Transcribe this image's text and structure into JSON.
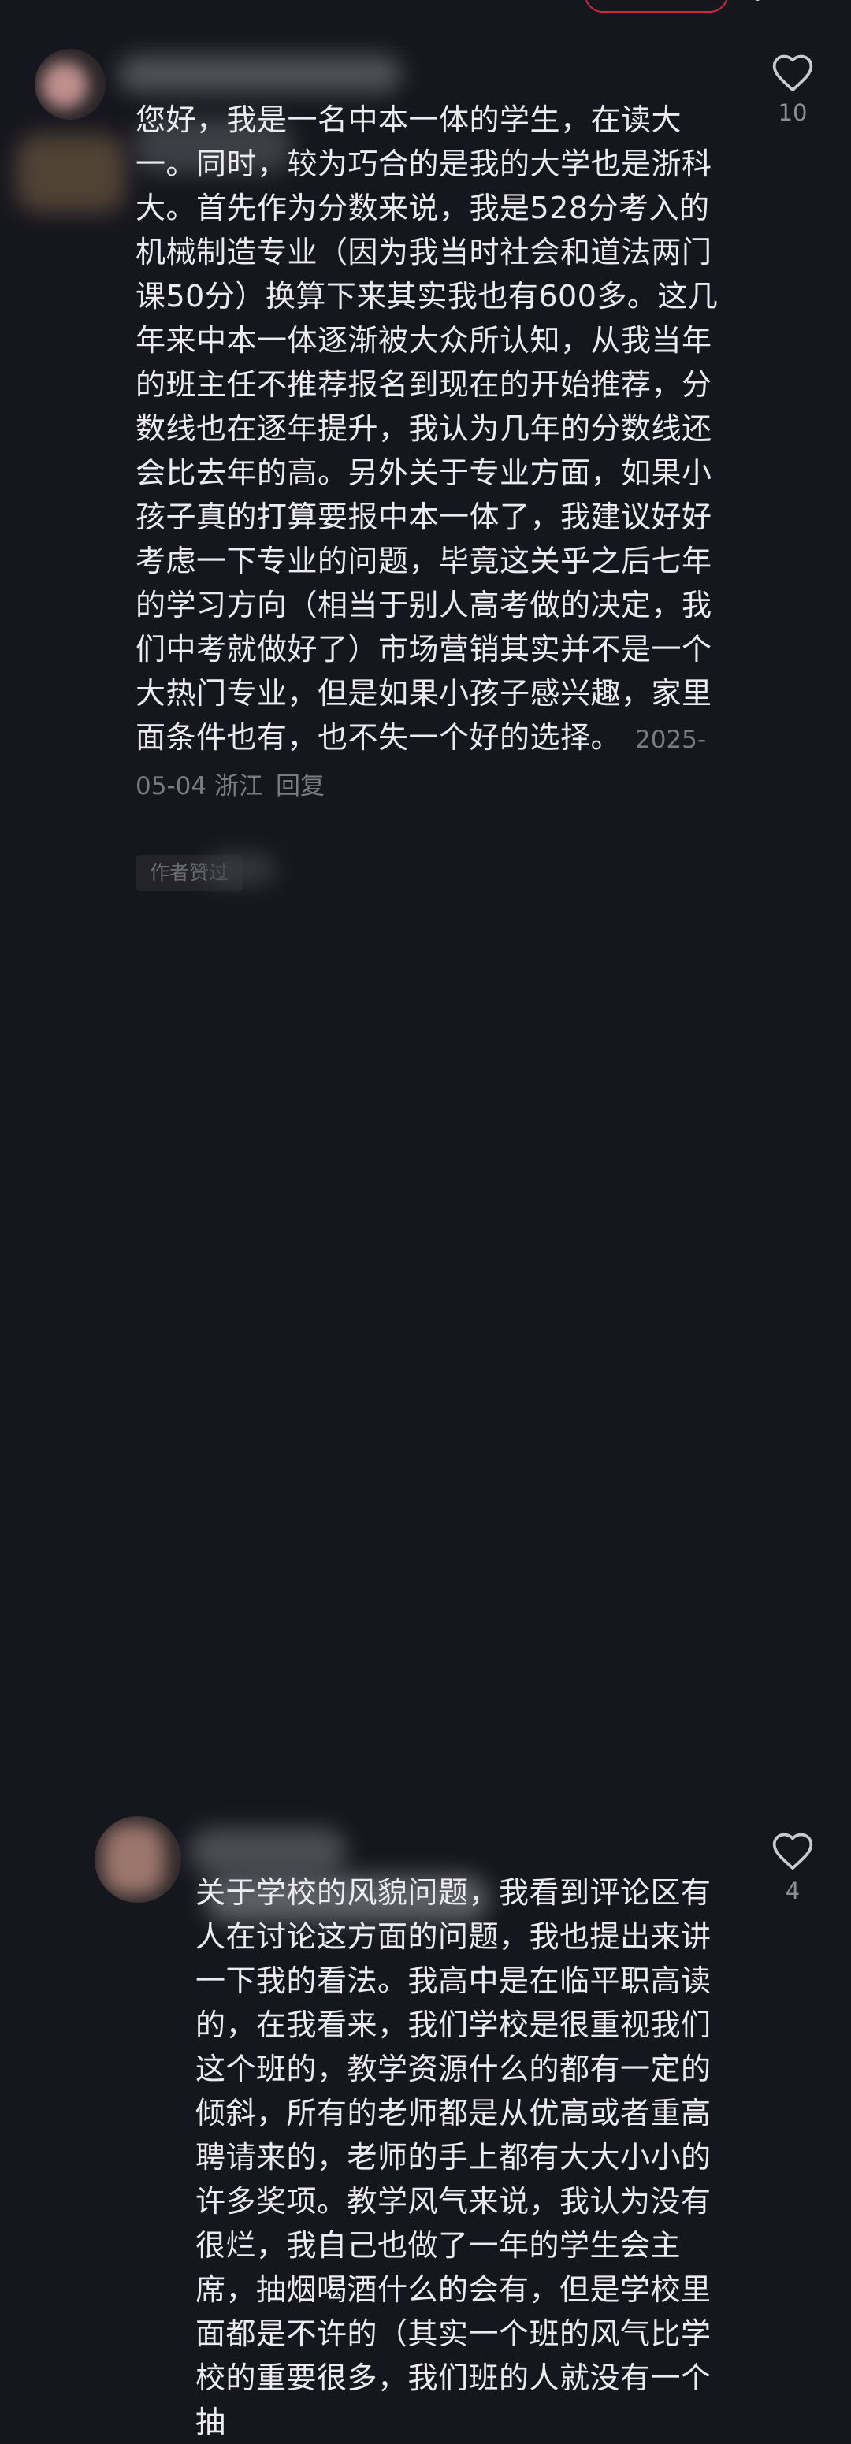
{
  "comments": [
    {
      "text": "您好，我是一名中本一体的学生，在读大一。同时，较为巧合的是我的大学也是浙科大。首先作为分数来说，我是528分考入的机械制造专业（因为我当时社会和道法两门课50分）换算下来其实我也有600多。这几年来中本一体逐渐被大众所认知，从我当年的班主任不推荐报名到现在的开始推荐，分数线也在逐年提升，我认为几年的分数线还会比去年的高。另外关于专业方面，如果小孩子真的打算要报中本一体了，我建议好好考虑一下专业的问题，毕竟这关乎之后七年的学习方向（相当于别人高考做的决定，我们中考就做好了）市场营销其实并不是一个大热门专业，但是如果小孩子感兴趣，家里面条件也有，也不失一个好的选择。",
      "date": "2025-05-04",
      "location": "浙江",
      "reply_label": "回复",
      "like_count": "10",
      "author_tag": "作者赞过"
    },
    {
      "text": "关于学校的风貌问题，我看到评论区有人在讨论这方面的问题，我也提出来讲一下我的看法。我高中是在临平职高读的，在我看来，我们学校是很重视我们这个班的，教学资源什么的都有一定的倾斜，所有的老师都是从优高或者重高聘请来的，老师的手上都有大大小小的许多奖项。教学风气来说，我认为没有很烂，我自己也做了一年的学生会主席，抽烟喝酒什么的会有，但是学校里面都是不许的（其实一个班的风气比学校的重要很多，我们班的人就没有一个抽",
      "like_count": "4"
    }
  ],
  "icons": {
    "like": "heart-outline-icon",
    "more": "more-dots-icon"
  },
  "colors": {
    "background": "#16161e",
    "text": "#ececf0",
    "meta": "#7b7b86",
    "accent": "#d0243f"
  }
}
